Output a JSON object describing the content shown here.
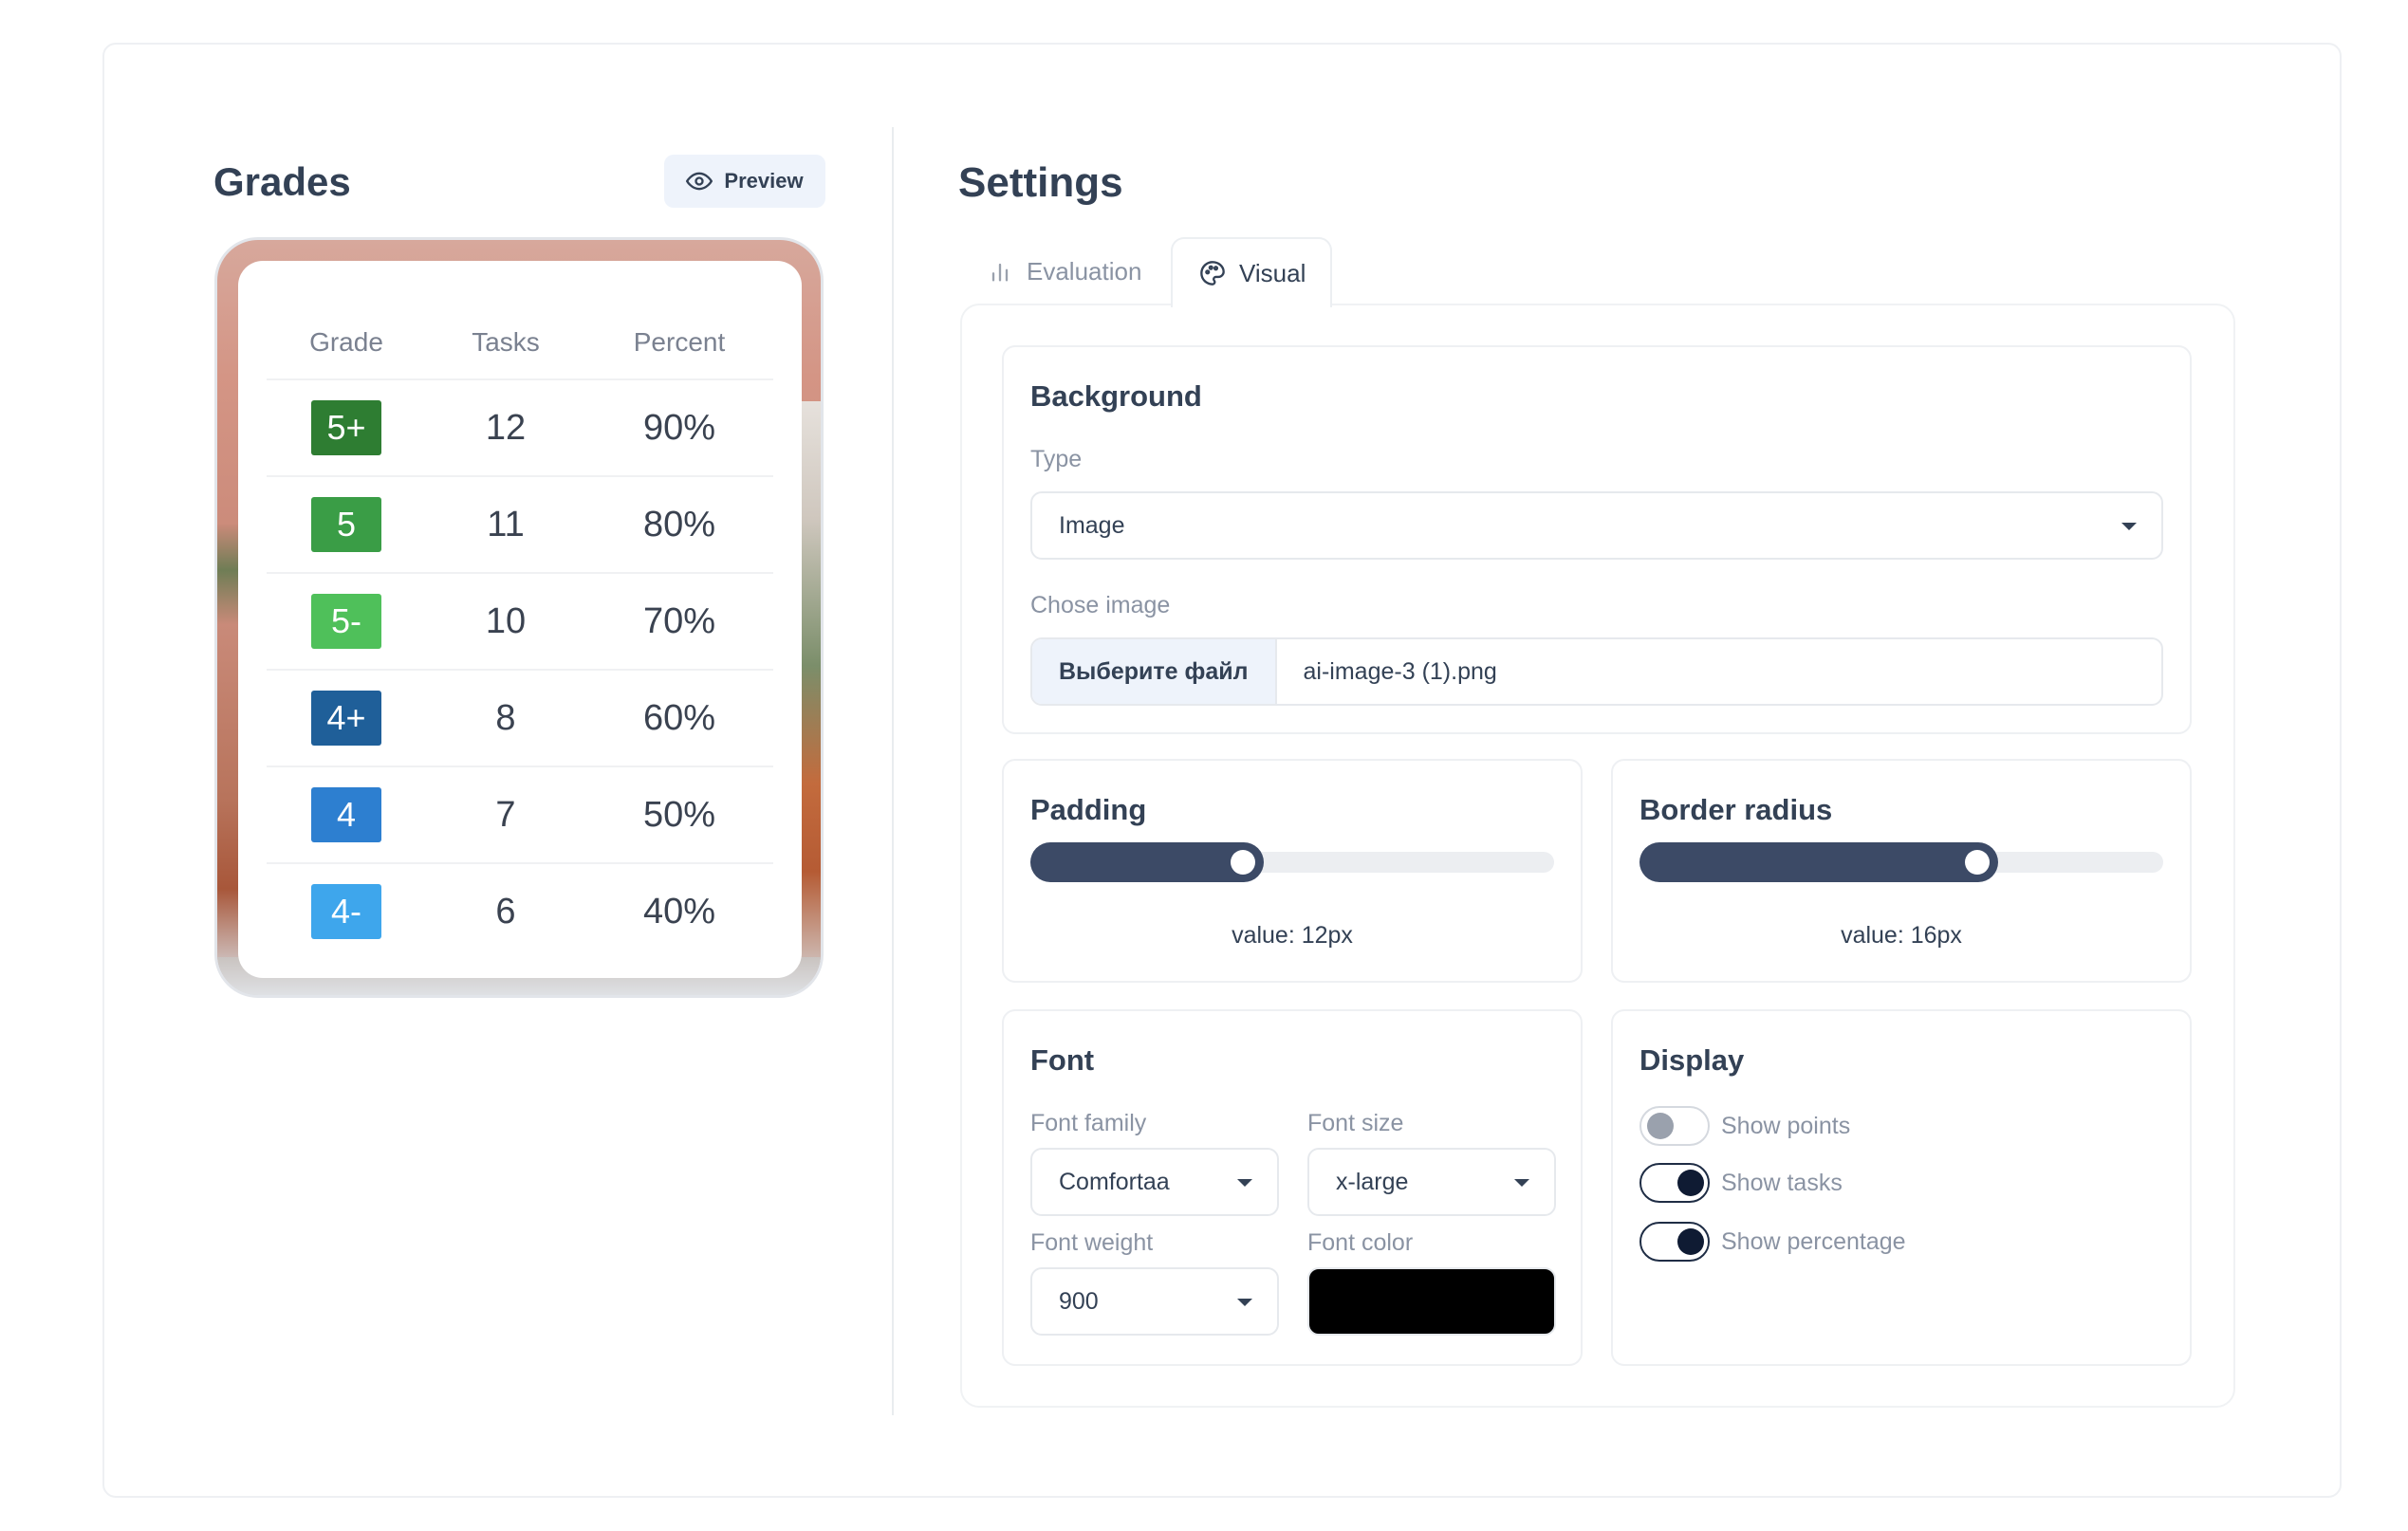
{
  "grades": {
    "title": "Grades",
    "preview_label": "Preview",
    "columns": [
      "Grade",
      "Tasks",
      "Percent"
    ],
    "rows": [
      {
        "grade": "5+",
        "tasks": "12",
        "percent": "90%",
        "color": "#2e7d32"
      },
      {
        "grade": "5",
        "tasks": "11",
        "percent": "80%",
        "color": "#3a9d46"
      },
      {
        "grade": "5-",
        "tasks": "10",
        "percent": "70%",
        "color": "#4fc05a"
      },
      {
        "grade": "4+",
        "tasks": "8",
        "percent": "60%",
        "color": "#1f5f99"
      },
      {
        "grade": "4",
        "tasks": "7",
        "percent": "50%",
        "color": "#2d7fd0"
      },
      {
        "grade": "4-",
        "tasks": "6",
        "percent": "40%",
        "color": "#3ea6ec"
      }
    ]
  },
  "settings": {
    "title": "Settings",
    "tabs": [
      {
        "label": "Evaluation",
        "icon": "bar-chart-icon",
        "active": false
      },
      {
        "label": "Visual",
        "icon": "palette-icon",
        "active": true
      }
    ],
    "background": {
      "title": "Background",
      "type_label": "Type",
      "type_value": "Image",
      "image_label": "Chose image",
      "file_button": "Выберите файл",
      "file_name": "ai-image-3 (1).png"
    },
    "padding": {
      "title": "Padding",
      "value_text": "value: 12px",
      "fraction": 0.42
    },
    "border_radius": {
      "title": "Border radius",
      "value_text": "value: 16px",
      "fraction": 0.66
    },
    "font": {
      "title": "Font",
      "family_label": "Font family",
      "family_value": "Comfortaa",
      "size_label": "Font size",
      "size_value": "x-large",
      "weight_label": "Font weight",
      "weight_value": "900",
      "color_label": "Font color",
      "color_value": "#000000"
    },
    "display": {
      "title": "Display",
      "toggles": [
        {
          "label": "Show points",
          "on": false
        },
        {
          "label": "Show tasks",
          "on": true
        },
        {
          "label": "Show percentage",
          "on": true
        }
      ]
    }
  }
}
